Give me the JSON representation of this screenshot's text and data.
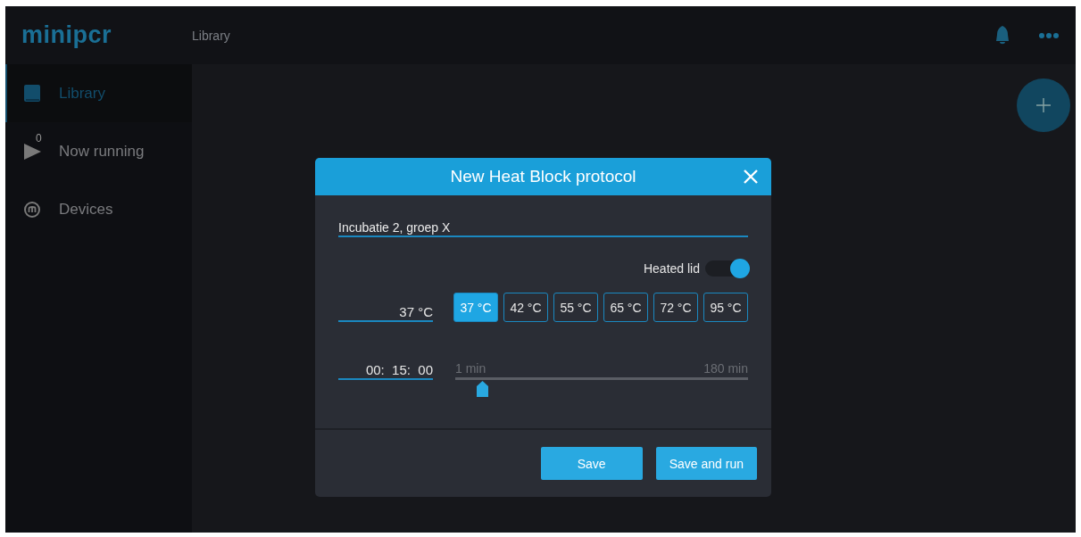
{
  "logo": "minipcr",
  "topbar": {
    "title": "Library"
  },
  "sidebar": {
    "items": [
      {
        "label": "Library",
        "kind": "book",
        "selected": true
      },
      {
        "label": "Now running",
        "kind": "play",
        "badge": "0",
        "selected": false
      },
      {
        "label": "Devices",
        "kind": "device",
        "selected": false
      }
    ]
  },
  "dialog": {
    "title": "New Heat Block protocol",
    "name_field": {
      "value": "Incubatie 2, groep X"
    },
    "heated_lid": {
      "label": "Heated lid",
      "on": true
    },
    "temperature": {
      "value": "37 °C"
    },
    "presets": [
      {
        "label": "37 °C",
        "selected": true
      },
      {
        "label": "42 °C",
        "selected": false
      },
      {
        "label": "55 °C",
        "selected": false
      },
      {
        "label": "65 °C",
        "selected": false
      },
      {
        "label": "72 °C",
        "selected": false
      },
      {
        "label": "95 °C",
        "selected": false
      }
    ],
    "time": {
      "value": "00:  15:  00"
    },
    "duration_slider": {
      "min_label": "1 min",
      "max_label": "180 min",
      "level": 0.09
    },
    "buttons": [
      "Save",
      "Save and run"
    ]
  }
}
